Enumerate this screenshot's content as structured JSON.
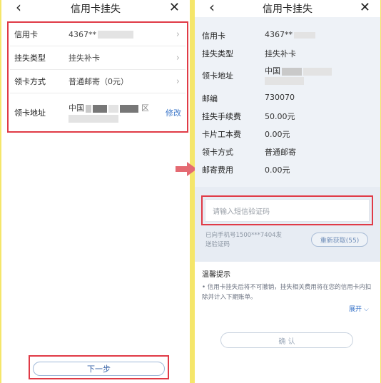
{
  "left": {
    "title": "信用卡挂失",
    "back_icon": "‹",
    "close_icon": "✕",
    "rows": [
      {
        "label": "信用卡",
        "value": "4367**"
      },
      {
        "label": "挂失类型",
        "value": "挂失补卡"
      },
      {
        "label": "领卡方式",
        "value": "普通邮寄（0元）"
      },
      {
        "label": "领卡地址",
        "value": "中国",
        "value_suffix": "区",
        "action": "修改"
      }
    ],
    "next_button": "下一步"
  },
  "right": {
    "title": "信用卡挂失",
    "back_icon": "‹",
    "close_icon": "✕",
    "rows": [
      {
        "label": "信用卡",
        "value": "4367**"
      },
      {
        "label": "挂失类型",
        "value": "挂失补卡"
      },
      {
        "label": "领卡地址",
        "value": "中国"
      },
      {
        "label": "邮编",
        "value": "730070"
      },
      {
        "label": "挂失手续费",
        "value": "50.00元"
      },
      {
        "label": "卡片工本费",
        "value": "0.00元"
      },
      {
        "label": "领卡方式",
        "value": "普通邮寄"
      },
      {
        "label": "邮寄费用",
        "value": "0.00元"
      }
    ],
    "sms_placeholder": "请输入短信验证码",
    "sent_line1": "已向手机号1500***7404发",
    "sent_line2": "送验证码",
    "resend_button": "重新获取(55)",
    "tips_title": "温馨提示",
    "tips_text": "• 信用卡挂失后将不可撤销，挂失相关费用将在您的信用卡内扣除并计入下期账单。",
    "expand_label": "展开",
    "confirm_button": "确 认"
  },
  "colors": {
    "highlight": "#e03a46",
    "link": "#3a75c9",
    "frame": "#f5e66a"
  }
}
